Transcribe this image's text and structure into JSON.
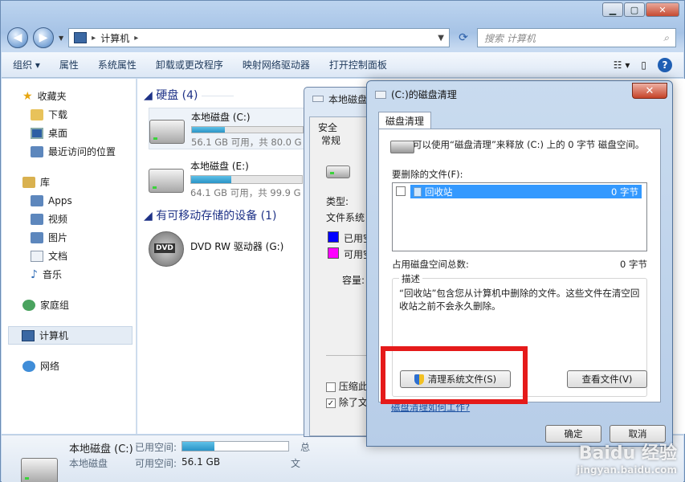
{
  "explorer": {
    "address_path": "计算机",
    "search_placeholder": "搜索 计算机",
    "toolbar": [
      "组织 ▾",
      "属性",
      "系统属性",
      "卸载或更改程序",
      "映射网络驱动器",
      "打开控制面板"
    ],
    "sidebar": {
      "favorites": "收藏夹",
      "favorites_items": [
        "下载",
        "桌面",
        "最近访问的位置"
      ],
      "libraries": "库",
      "library_items": [
        "Apps",
        "视频",
        "图片",
        "文档",
        "音乐"
      ],
      "homegroup": "家庭组",
      "computer": "计算机",
      "network": "网络"
    },
    "groups": {
      "hdd": "硬盘 (4)",
      "removable": "有可移动存储的设备 (1)"
    },
    "drives": [
      {
        "name": "本地磁盘 (C:)",
        "usage": 0.3,
        "info": "56.1 GB 可用，共 80.0 G"
      },
      {
        "name": "本地磁盘 (E:)",
        "usage": 0.36,
        "info": "64.1 GB 可用，共 99.9 G"
      },
      {
        "name": "DVD RW 驱动器 (G:)"
      }
    ],
    "details": {
      "name": "本地磁盘 (C:)",
      "type": "本地磁盘",
      "used_label": "已用空间:",
      "used_fraction": 0.3,
      "free_label": "可用空间:",
      "free_value": "56.1 GB",
      "trunc1": "总",
      "trunc2": "文"
    }
  },
  "props": {
    "title": "本地磁盘",
    "tab_security": "安全",
    "tab_general": "常规",
    "type_label": "类型:",
    "fs_label": "文件系统",
    "used_label": "已用空",
    "free_label": "可用空",
    "capacity_label": "容量:",
    "compress_label": "压缩此",
    "index_label": "除了文",
    "used_color": "#0000ff",
    "free_color": "#ff00ff"
  },
  "cleanup": {
    "title": "(C:)的磁盘清理",
    "close": "✕",
    "tab": "磁盘清理",
    "intro": "可以使用“磁盘清理”来释放 (C:) 上的 0 字节 磁盘空间。",
    "files_label": "要删除的文件(F):",
    "list": [
      {
        "name": "回收站",
        "size": "0 字节",
        "checked": false
      }
    ],
    "total_label": "占用磁盘空间总数:",
    "total_value": "0 字节",
    "desc_legend": "描述",
    "desc_text": "“回收站”包含您从计算机中删除的文件。这些文件在清空回收站之前不会永久删除。",
    "clean_system_button": "清理系统文件(S)",
    "view_files_button": "查看文件(V)",
    "link": "磁盘清理如何工作?",
    "ok": "确定",
    "cancel": "取消",
    "highlight_color": "#e51a1a"
  },
  "watermark": {
    "line1": "Baidu 经验",
    "line2": "jingyan.baidu.com"
  }
}
